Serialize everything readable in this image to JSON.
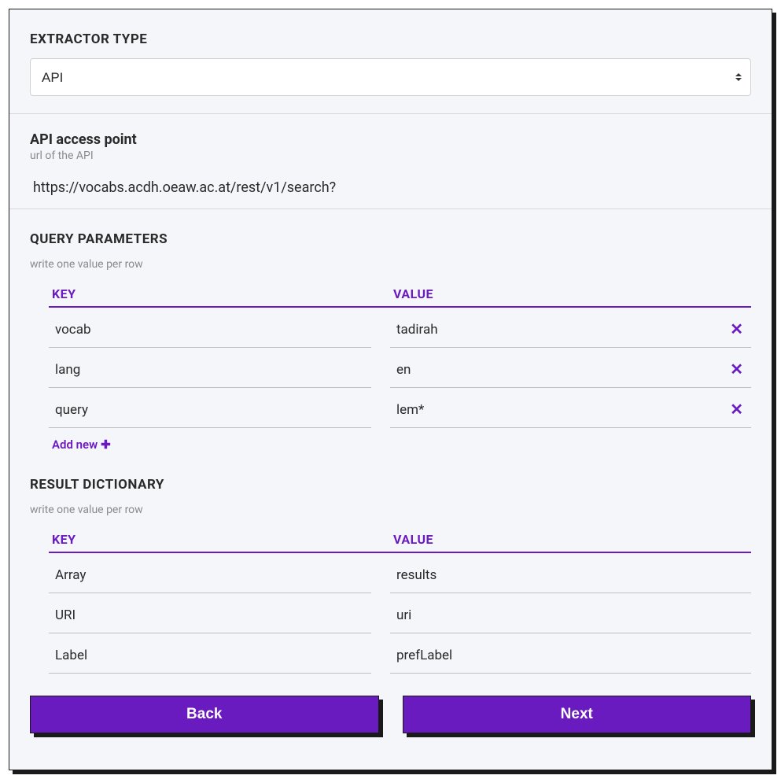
{
  "extractor": {
    "heading": "EXTRACTOR TYPE",
    "selected": "API"
  },
  "api": {
    "heading": "API access point",
    "help": "url of the API",
    "url": "https://vocabs.acdh.oeaw.ac.at/rest/v1/search?"
  },
  "query_params": {
    "heading": "QUERY PARAMETERS",
    "help": "write one value per row",
    "key_header": "KEY",
    "value_header": "VALUE",
    "rows": [
      {
        "key": "vocab",
        "value": "tadirah"
      },
      {
        "key": "lang",
        "value": "en"
      },
      {
        "key": "query",
        "value": "lem*"
      }
    ],
    "add_new_label": "Add new"
  },
  "result_dict": {
    "heading": "RESULT DICTIONARY",
    "help": "write one value per row",
    "key_header": "KEY",
    "value_header": "VALUE",
    "rows": [
      {
        "key": "Array",
        "value": "results"
      },
      {
        "key": "URI",
        "value": "uri"
      },
      {
        "key": "Label",
        "value": "prefLabel"
      }
    ]
  },
  "buttons": {
    "back": "Back",
    "next": "Next"
  },
  "colors": {
    "accent": "#6a1bbf",
    "panel_bg": "#f5f6fa"
  }
}
